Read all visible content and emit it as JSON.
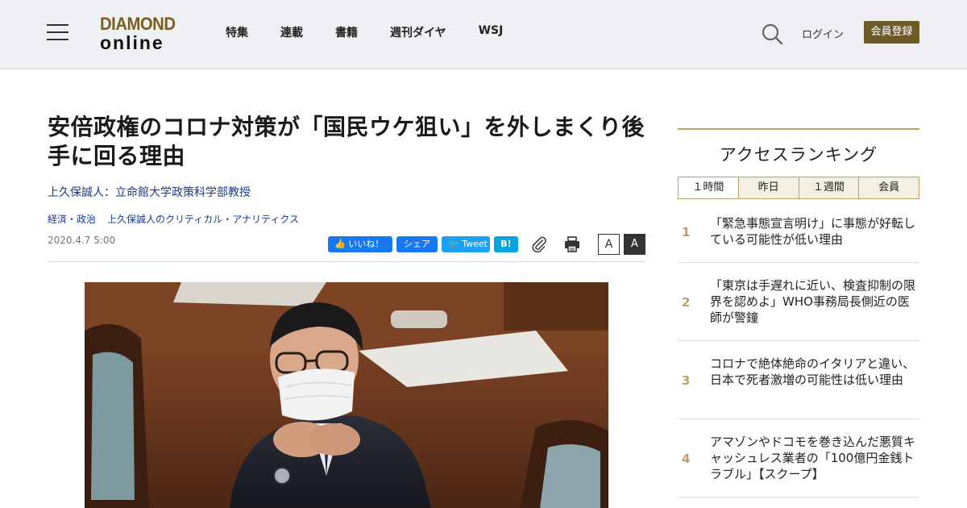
{
  "header": {
    "logo_top": "DIAMOND",
    "logo_bottom": "online",
    "nav": [
      "特集",
      "連載",
      "書籍",
      "週刊ダイヤ",
      "WSJ"
    ],
    "login": "ログイン",
    "register": "会員登録"
  },
  "article": {
    "title": "安倍政権のコロナ対策が「国民ウケ狙い」を外しまくり後手に回る理由",
    "author": "上久保誠人：立命館大学政策科学部教授",
    "tags": [
      "経済・政治",
      "上久保誠人のクリティカル・アナリティクス"
    ],
    "date": "2020.4.7 5:00"
  },
  "social": {
    "like": "いいね！",
    "share": "シェア",
    "tweet": "Tweet",
    "hatena": "B!",
    "font_small": "A",
    "font_large": "A"
  },
  "ranking": {
    "title": "アクセスランキング",
    "tabs": [
      "１時間",
      "昨日",
      "１週間",
      "会員"
    ],
    "items": [
      {
        "num": "1",
        "text": "「緊急事態宣言明け」に事態が好転している可能性が低い理由"
      },
      {
        "num": "2",
        "text": "「東京は手遅れに近い、検査抑制の限界を認めよ」WHO事務局長側近の医師が警鐘"
      },
      {
        "num": "3",
        "text": "コロナで絶体絶命のイタリアと違い、日本で死者激増の可能性は低い理由"
      },
      {
        "num": "4",
        "text": "アマゾンやドコモを巻き込んだ悪質キャッシュレス業者の「100億円金銭トラブル」【スクープ】"
      }
    ]
  },
  "colors": {
    "brand_gold": "#7a5f1c",
    "register_bg": "#6b5a2a",
    "link_blue": "#1a3a8f",
    "facebook": "#1877f2",
    "twitter": "#1da1f2",
    "hatena": "#00a4de",
    "rank_accent": "#b8a06a"
  }
}
